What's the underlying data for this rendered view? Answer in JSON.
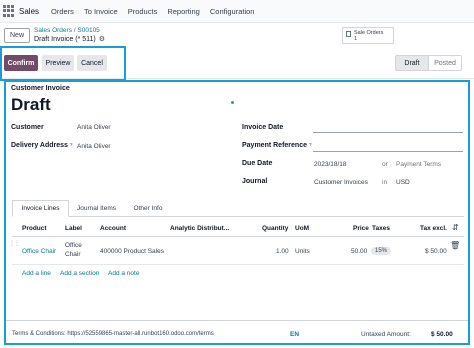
{
  "navbar": {
    "brand": "Sales",
    "items": [
      "Orders",
      "To Invoice",
      "Products",
      "Reporting",
      "Configuration"
    ]
  },
  "control_panel": {
    "new_label": "New",
    "breadcrumb_parent": "Sales Orders",
    "breadcrumb_order": "S00105",
    "record_title": "Draft Invoice (* 511)",
    "smart_button": {
      "label": "Sale Orders",
      "count": "1"
    }
  },
  "actions": {
    "confirm": "Confirm",
    "preview": "Preview",
    "cancel": "Cancel"
  },
  "statusbar": {
    "active": "Draft",
    "next": "Posted"
  },
  "form": {
    "doc_type": "Customer Invoice",
    "state_title": "Draft",
    "customer_label": "Customer",
    "customer_value": "Anita Oliver",
    "delivery_label": "Delivery Address",
    "delivery_help": "?",
    "delivery_value": "Anita Oliver",
    "invoice_date_label": "Invoice Date",
    "payment_ref_label": "Payment Reference",
    "payment_ref_help": "?",
    "due_date_label": "Due Date",
    "due_date_value": "2023/18/18",
    "or_text": "or",
    "payment_terms_placeholder": "Payment Terms",
    "journal_label": "Journal",
    "journal_value": "Customer Invoices",
    "in_text": "in",
    "currency_value": "USD"
  },
  "tabs": [
    "Invoice Lines",
    "Journal Items",
    "Other Info"
  ],
  "lines_table": {
    "headers": {
      "product": "Product",
      "label": "Label",
      "account": "Account",
      "analytic": "Analytic Distribut...",
      "quantity": "Quantity",
      "uom": "UoM",
      "price": "Price",
      "taxes": "Taxes",
      "tax_excl": "Tax excl."
    },
    "rows": [
      {
        "product": "Office Chair",
        "label_line1": "Office",
        "label_line2": "Chair",
        "account": "400000 Product Sales",
        "analytic": "",
        "quantity": "1.00",
        "uom": "Units",
        "price": "50.00",
        "taxes": "15%",
        "subtotal": "$ 50.00"
      }
    ],
    "add_line": "Add a line",
    "add_section": "Add a section",
    "add_note": "Add a note"
  },
  "footer": {
    "terms": "Terms & Conditions: https://52559865-master-all.runbot160.odoo.com/terms",
    "lang": "EN",
    "untaxed_label": "Untaxed Amount:",
    "untaxed_value": "$ 50.00"
  }
}
